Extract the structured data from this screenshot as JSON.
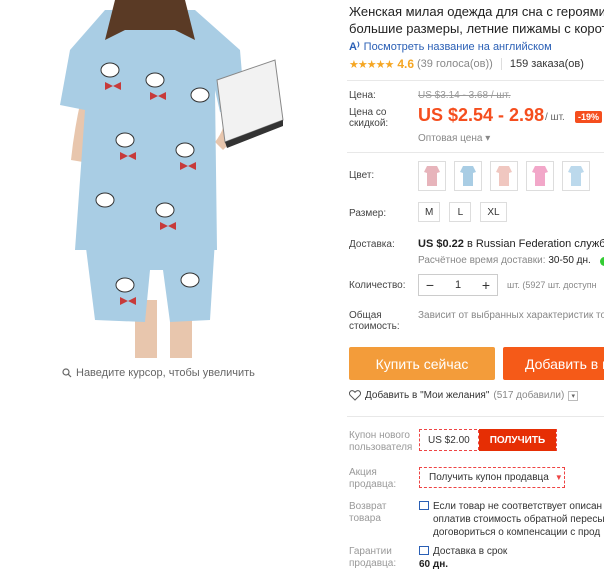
{
  "product": {
    "title_line1": "Женская милая одежда для сна с героями му",
    "title_line2": "большие размеры, летние пижамы с коротк",
    "translate_link": "Посмотреть название на английском",
    "rating_value": "4.6",
    "votes": "(39 голоса(ов))",
    "orders": "159 заказа(ов)",
    "stars": "★★★★★"
  },
  "price": {
    "price_label": "Цена:",
    "old_price": "US $3.14 - 3.68 / шт.",
    "discount_label": "Цена со скидкой:",
    "new_price": "US $2.54 - 2.98",
    "unit": "/ шт.",
    "discount_badge": "-19%",
    "wholesale": "Оптовая цена ▾"
  },
  "options": {
    "color_label": "Цвет:",
    "color_count": 5,
    "size_label": "Размер:",
    "sizes": [
      "M",
      "L",
      "XL"
    ]
  },
  "shipping": {
    "label": "Доставка:",
    "price": "US $0.22",
    "text": "в Russian Federation службой",
    "eta_label": "Расчётное время доставки:",
    "eta_value": "30-50 дн."
  },
  "quantity": {
    "label": "Количество:",
    "value": "1",
    "minus": "−",
    "plus": "+",
    "note": "шт. (5927 шт. доступн"
  },
  "total": {
    "label": "Общая стоимость:",
    "value": "Зависит от выбранных характеристик то"
  },
  "actions": {
    "buy_now": "Купить сейчас",
    "add_to_cart": "Добавить в к",
    "wishlist": "Добавить в \"Мои желания\"",
    "wishlist_count": "(517 добавили)"
  },
  "coupons": {
    "new_user_label": "Купон нового пользователя",
    "new_user_value": "US $2.00",
    "get_button": "ПОЛУЧИТЬ",
    "seller_label": "Акция продавца:",
    "seller_button": "Получить купон продавца",
    "return_label": "Возврат товара",
    "return_text_1": "Если товар не соответствует описан",
    "return_text_2": "оплатив стоимость обратной пересы",
    "return_text_3": "договориться о компенсации с прод",
    "guarantee_label": "Гарантии продавца:",
    "guarantee_text": "Доставка в срок",
    "guarantee_days": "60 дн."
  },
  "gallery": {
    "zoom_hint": "Наведите курсор, чтобы увеличить"
  },
  "colors": {
    "accent": "#f54e1e",
    "buy_button": "#f39c3a",
    "cart_button": "#f55a18",
    "pajama": "#a9cde4",
    "link": "#2a5fb5"
  }
}
